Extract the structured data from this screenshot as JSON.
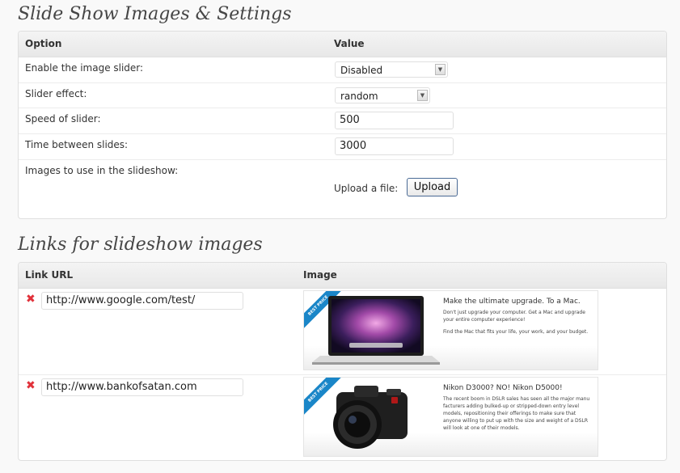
{
  "settings": {
    "title": "Slide Show Images & Settings",
    "col_option": "Option",
    "col_value": "Value",
    "rows": {
      "enable": {
        "label": "Enable the image slider:",
        "value": "Disabled"
      },
      "effect": {
        "label": "Slider effect:",
        "value": "random"
      },
      "speed": {
        "label": "Speed of slider:",
        "value": "500"
      },
      "time": {
        "label": "Time between slides:",
        "value": "3000"
      },
      "images": {
        "label": "Images to use in the slideshow:",
        "upload_label": "Upload a file:",
        "upload_button": "Upload"
      }
    }
  },
  "links": {
    "title": "Links for slideshow images",
    "col_link": "Link URL",
    "col_image": "Image",
    "rows": [
      {
        "url": "http://www.google.com/test/",
        "ribbon": "BEST PRICE",
        "ad_title": "Make the ultimate upgrade. To a Mac.",
        "ad_text": "Don't just upgrade your computer. Get a Mac and upgrade your entire computer experience!",
        "ad_text2": "Find the Mac that fits your life, your work, and your budget."
      },
      {
        "url": "http://www.bankofsatan.com",
        "ribbon": "BEST PRICE",
        "ad_title": "Nikon D3000? NO! Nikon D5000!",
        "ad_text": "The recent boom in DSLR sales has seen all the major manu facturers adding bulked-up or stripped-down entry level models, repositioning their offerings to make sure that anyone willing to put up with the size and weight of a DSLR will look at one of their models.",
        "ad_text2": ""
      }
    ]
  },
  "icons": {
    "delete": "delete-x-icon",
    "dropdown": "chevron-down-icon"
  },
  "colors": {
    "delete": "#e1313a",
    "ribbon": "#1a86c8",
    "button_border": "#4a6a95"
  }
}
